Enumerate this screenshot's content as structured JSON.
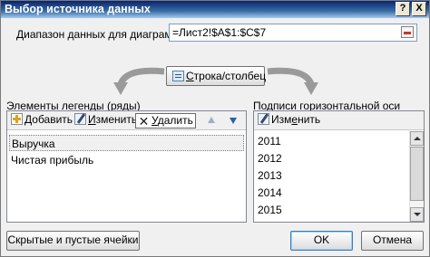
{
  "window": {
    "title": "Выбор источника данных",
    "help_glyph": "?",
    "close_glyph": "X"
  },
  "range": {
    "label": "Диапазон данных для диаграммы:",
    "value": "=Лист2!$A$1:$C$7"
  },
  "switch_button": {
    "label_underlined": "С",
    "label_rest": "трока/столбец",
    "icon": "switch-row-column-icon"
  },
  "legend": {
    "label": "Элементы легенды (ряды)",
    "toolbar": {
      "add_underlined": "Д",
      "add_rest": "обавить",
      "edit_underlined": "И",
      "edit_rest": "зменить",
      "delete_underlined": "У",
      "delete_rest": "далить"
    },
    "series": [
      "Выручка",
      "Чистая прибыль"
    ]
  },
  "axis": {
    "label": "Подписи горизонтальной оси (категории)",
    "toolbar": {
      "edit_prefix": "Изм",
      "edit_underlined": "е",
      "edit_rest": "нить"
    },
    "categories": [
      "2011",
      "2012",
      "2013",
      "2014",
      "2015"
    ]
  },
  "buttons": {
    "hidden_cells": "Скрытые и пустые ячейки",
    "ok": "OK",
    "cancel": "Отмена"
  },
  "colors": {
    "titlebar_start": "#0a246a",
    "titlebar_end": "#a6caf0",
    "dialog_bg": "#f0f0f0"
  }
}
